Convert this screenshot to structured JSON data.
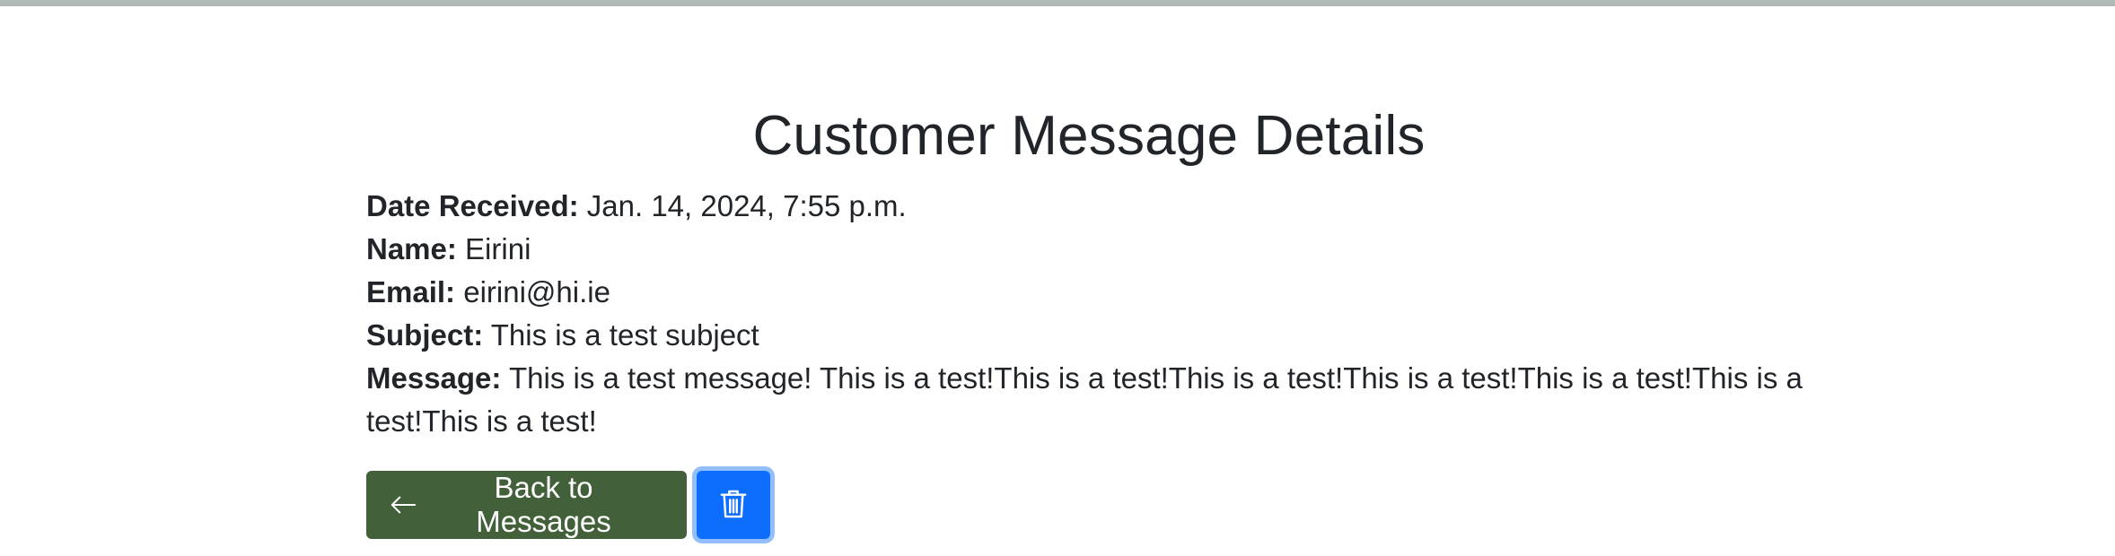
{
  "page": {
    "title": "Customer Message Details"
  },
  "message": {
    "date_label": "Date Received:",
    "date_value": "Jan. 14, 2024, 7:55 p.m.",
    "name_label": "Name:",
    "name_value": "Eirini",
    "email_label": "Email:",
    "email_value": "eirini@hi.ie",
    "subject_label": "Subject:",
    "subject_value": "This is a test subject",
    "message_label": "Message:",
    "message_value": "This is a test message! This is a test!This is a test!This is a test!This is a test!This is a test!This is a test!This is a test!"
  },
  "actions": {
    "back_label": "Back to Messages",
    "back_icon": "arrow-left-icon",
    "delete_icon": "trash-icon"
  },
  "colors": {
    "top_bar": "#b1b9b6",
    "back_button": "#42603a",
    "delete_button": "#0d6efd",
    "text": "#212529"
  }
}
